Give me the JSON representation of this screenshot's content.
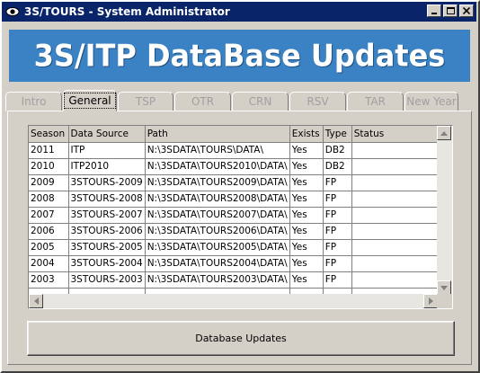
{
  "window": {
    "title": "3S/TOURS - System Administrator"
  },
  "banner": {
    "title": "3S/ITP DataBase Updates"
  },
  "tabs": [
    {
      "label": "Intro",
      "active": false
    },
    {
      "label": "General",
      "active": true
    },
    {
      "label": "TSP",
      "active": false
    },
    {
      "label": "OTR",
      "active": false
    },
    {
      "label": "CRN",
      "active": false
    },
    {
      "label": "RSV",
      "active": false
    },
    {
      "label": "TAR",
      "active": false
    },
    {
      "label": "New Year",
      "active": false
    }
  ],
  "grid": {
    "columns": [
      "Season",
      "Data Source",
      "Path",
      "Exists",
      "Type",
      "Status"
    ],
    "rows": [
      [
        "2011",
        "ITP",
        "N:\\3SDATA\\TOURS\\DATA\\",
        "Yes",
        "DB2",
        ""
      ],
      [
        "2010",
        "ITP2010",
        "N:\\3SDATA\\TOURS2010\\DATA\\",
        "Yes",
        "DB2",
        ""
      ],
      [
        "2009",
        "3STOURS-2009",
        "N:\\3SDATA\\TOURS2009\\DATA\\",
        "Yes",
        "FP",
        ""
      ],
      [
        "2008",
        "3STOURS-2008",
        "N:\\3SDATA\\TOURS2008\\DATA\\",
        "Yes",
        "FP",
        ""
      ],
      [
        "2007",
        "3STOURS-2007",
        "N:\\3SDATA\\TOURS2007\\DATA\\",
        "Yes",
        "FP",
        ""
      ],
      [
        "2006",
        "3STOURS-2006",
        "N:\\3SDATA\\TOURS2006\\DATA\\",
        "Yes",
        "FP",
        ""
      ],
      [
        "2005",
        "3STOURS-2005",
        "N:\\3SDATA\\TOURS2005\\DATA\\",
        "Yes",
        "FP",
        ""
      ],
      [
        "2004",
        "3STOURS-2004",
        "N:\\3SDATA\\TOURS2004\\DATA\\",
        "Yes",
        "FP",
        ""
      ],
      [
        "2003",
        "3STOURS-2003",
        "N:\\3SDATA\\TOURS2003\\DATA\\",
        "Yes",
        "FP",
        ""
      ]
    ]
  },
  "actions": {
    "database_updates_label": "Database Updates"
  },
  "colors": {
    "titlebar": "#0a246a",
    "banner": "#3b82c4",
    "face": "#d4d0c8"
  }
}
